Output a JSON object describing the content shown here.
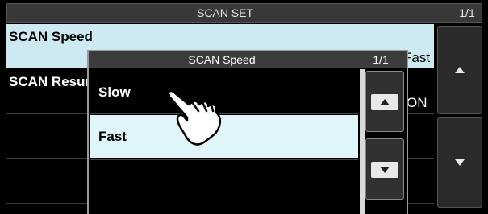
{
  "screen": {
    "title": "SCAN SET",
    "page": "1/1",
    "rows": [
      {
        "label": "SCAN Speed",
        "value": "Fast"
      },
      {
        "label": "SCAN Resume",
        "value": "ON"
      }
    ],
    "side_buttons": {
      "up_icon": "triangle-up-icon",
      "down_icon": "triangle-down-icon"
    }
  },
  "dialog": {
    "title": "SCAN Speed",
    "page": "1/1",
    "options": [
      {
        "label": "Slow",
        "selected": false
      },
      {
        "label": "Fast",
        "selected": true
      }
    ],
    "up_icon": "triangle-up-icon",
    "down_icon": "triangle-down-icon"
  },
  "colors": {
    "background": "#000000",
    "highlight": "#cdeaf3",
    "selected_option": "#dff5f9",
    "title_bar": "#383838",
    "text": "#ffffff"
  },
  "pointer": {
    "icon": "pointing-hand-icon"
  }
}
